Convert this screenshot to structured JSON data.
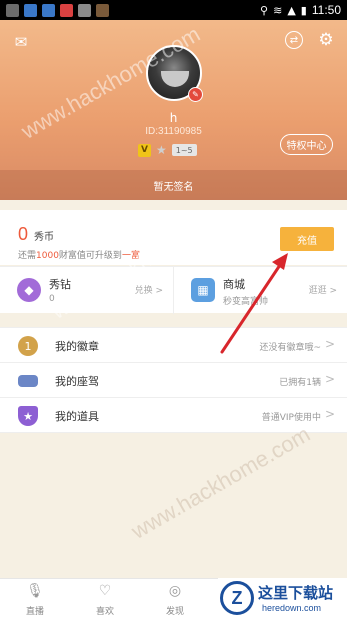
{
  "status_bar": {
    "time": "11:50"
  },
  "profile": {
    "username": "h",
    "user_id": "ID:31190985",
    "vip_badge": "V",
    "level_badge": "1~5",
    "privilege_button": "特权中心",
    "signature": "暂无签名"
  },
  "coins": {
    "count": "0",
    "unit": "秀币",
    "upgrade_prefix": "还需",
    "upgrade_amount": "1000",
    "upgrade_middle": "财富值可升级到",
    "upgrade_target": "一富",
    "recharge_button": "充值"
  },
  "shops": [
    {
      "label": "秀钻",
      "sub": "0",
      "action": "兑换 >"
    },
    {
      "label": "商城",
      "sub": "秒变高富帅",
      "action": "逛逛 >"
    }
  ],
  "menu": [
    {
      "label": "我的徽章",
      "status": "还没有徽章哦~",
      "arrow": ">"
    },
    {
      "label": "我的座驾",
      "status": "已拥有1辆",
      "arrow": ">"
    },
    {
      "label": "我的道具",
      "status": "普通VIP使用中",
      "arrow": ">"
    }
  ],
  "bottom_nav": [
    {
      "label": "直播"
    },
    {
      "label": "喜欢"
    },
    {
      "label": "发现"
    }
  ],
  "watermark": "www.hackhome.com",
  "download_logo": {
    "title": "这里下载站",
    "subtitle": "heredown.com",
    "mark": "Z"
  },
  "colors": {
    "accent": "#ee5a3b",
    "recharge": "#f6b23c",
    "header": "#eb9f6f",
    "annotation": "#d8262c"
  }
}
